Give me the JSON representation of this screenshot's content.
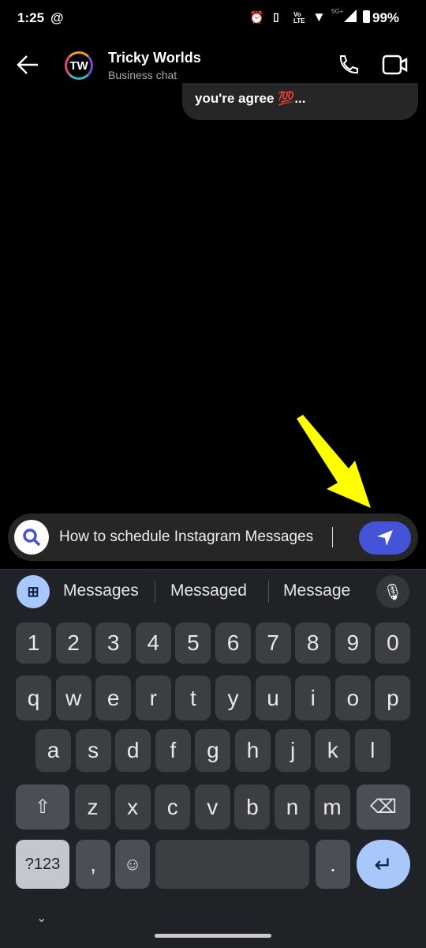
{
  "status": {
    "time": "1:25",
    "battery": "99%",
    "network": "5G+"
  },
  "header": {
    "title": "Tricky Worlds",
    "subtitle": "Business chat",
    "avatar_text": "TW"
  },
  "messages": [
    {
      "text": "you're agree 💯..."
    }
  ],
  "composer": {
    "value": "How to schedule Instagram Messages"
  },
  "keyboard": {
    "suggestions": [
      "Messages",
      "Messaged",
      "Message"
    ],
    "row1": [
      "1",
      "2",
      "3",
      "4",
      "5",
      "6",
      "7",
      "8",
      "9",
      "0"
    ],
    "row2": [
      "q",
      "w",
      "e",
      "r",
      "t",
      "y",
      "u",
      "i",
      "o",
      "p"
    ],
    "row3": [
      "a",
      "s",
      "d",
      "f",
      "g",
      "h",
      "j",
      "k",
      "l"
    ],
    "row4": [
      "z",
      "x",
      "c",
      "v",
      "b",
      "n",
      "m"
    ],
    "symbols_label": "?123",
    "comma": ",",
    "period": "."
  },
  "colors": {
    "accent": "#4553d6",
    "annotation": "#ffff00",
    "enter_key": "#a8c7fa"
  }
}
